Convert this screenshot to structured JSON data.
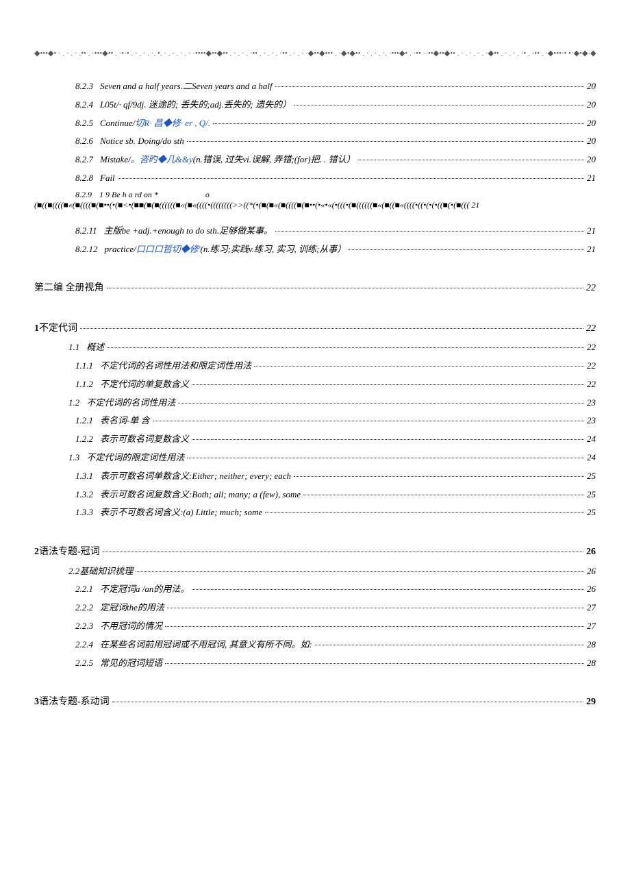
{
  "header": {
    "dots": "◆•••◆• · . · . · .•• . ·•••◆•• . ·•·• . · . · . ·. •. · . · . · . · ·••••◆••◆•• . · . · . ·•• . · . · . ·•• . · . · ·◆••◆••• . ·◆•◆•• . · . · . ·. ·•••◆• . ·•• ··••◆••◆•• . · . · . · . ·◆•• . · . · . ·• . ·•• . ·◆•••·• •·◆•◆·◆",
    "page": "20"
  },
  "entries": [
    {
      "lvl": 3,
      "num": "8.2.3",
      "txt": "Seven and a half years.二Seven years and a half",
      "pg": "20"
    },
    {
      "lvl": 3,
      "num": "8.2.4",
      "txt": "L05t/· qf/9dj. 迷途的; 丢失的;adj.丢失的; 遗失的）",
      "pg": "20"
    },
    {
      "lvl": 3,
      "num": "8.2.5",
      "txt": "Continue/<span class=\"link-blue\">切R· 昌◆修· er , Q/.</span>",
      "pg": "20"
    },
    {
      "lvl": 3,
      "num": "8.2.6",
      "txt": "Notice sb. Doing/do sth",
      "pg": "20"
    },
    {
      "lvl": 3,
      "num": "8.2.7",
      "txt": "Mistake/<span class=\"link-blue\">。咨旳◆几&&y</span>(n.错误, 过失vi.误解, 弄错;(for)把. . 错认）",
      "pg": "20"
    },
    {
      "lvl": 3,
      "num": "8.2.8",
      "txt": "Fail",
      "pg": "21"
    }
  ],
  "garbled": {
    "num": "8.2.9",
    "txt": "1  9 Be h a rd on *&nbsp;&nbsp;&nbsp;&nbsp;&nbsp;&nbsp;&nbsp;&nbsp;&nbsp;&nbsp;&nbsp;&nbsp;&nbsp;&nbsp;&nbsp;&nbsp;&nbsp;&nbsp;&nbsp;&nbsp;&nbsp;&nbsp;&nbsp;o",
    "line2": "(■((■((((■«(■((((■(■••(•(■<•(■■(■(■((((((■«(■«((((•((((((((>>((*(•(■(■«(■((((■(■••(•«•«(•(((•(■((((((■«(■((■«((((•((•(•(•((■(•(■(((  21"
  },
  "entries2": [
    {
      "lvl": 3,
      "num": "8.2.11",
      "txt": "主版be +adj.+enough to do sth.足够做某事。",
      "pg": "21"
    },
    {
      "lvl": 3,
      "num": "8.2.12",
      "txt": "practice/<span class=\"link-blue\">口口口哲切◆修'</span>(n.练习;实践v.练习, 实习, 训练;从事）",
      "pg": "21"
    },
    {
      "lvl": 0,
      "num": "",
      "txt": "第二编 全册视角",
      "pg": "<i>22</i>"
    },
    {
      "lvl": 0,
      "num": "",
      "txt": "<b>1</b>不定代词",
      "pg": "<i>22</i>"
    },
    {
      "lvl": 2,
      "num": "1.1",
      "txt": "概述",
      "pg": "22"
    },
    {
      "lvl": 3,
      "num": "1.1.1",
      "txt": "不定代词的名词性用法和限定词性用法",
      "pg": "22"
    },
    {
      "lvl": 3,
      "num": "1.1.2",
      "txt": "不定代词的单复数含义",
      "pg": "22"
    },
    {
      "lvl": 2,
      "num": "1.2",
      "txt": "不定代词的名词性用法",
      "pg": "23"
    },
    {
      "lvl": 3,
      "num": "1.2.1",
      "txt": "表名词-单  含",
      "pg": "23"
    },
    {
      "lvl": 3,
      "num": "1.2.2",
      "txt": "表示可数名词复数含义",
      "pg": "24"
    },
    {
      "lvl": 2,
      "num": "1.3",
      "txt": "不定代词的限定词性用法",
      "pg": "24"
    },
    {
      "lvl": 3,
      "num": "1.3.1",
      "txt": "表示可数名词单数含义:Either; neither; every; each",
      "pg": "25"
    },
    {
      "lvl": 3,
      "num": "1.3.2",
      "txt": "表示可数名词复数含义:Both; all; many; a (few), some",
      "pg": "25"
    },
    {
      "lvl": 3,
      "num": "1.3.3",
      "txt": "表示不可数名词含义:(a) Little; much; some",
      "pg": "25"
    },
    {
      "lvl": 0,
      "num": "",
      "txt": "<b>2</b>语法专题-冠词",
      "pg": "<b>26</b>"
    },
    {
      "lvl": 2,
      "num": "",
      "txt": "2.2基础知识梳理",
      "pg": "26"
    },
    {
      "lvl": 3,
      "num": "2.2.1",
      "txt": "不定冠词a /an的用法。",
      "pg": "26"
    },
    {
      "lvl": 3,
      "num": "2.2.2",
      "txt": "定冠词the的用法",
      "pg": "27"
    },
    {
      "lvl": 3,
      "num": "2.2.3",
      "txt": "不用冠词的情况",
      "pg": "27"
    },
    {
      "lvl": 3,
      "num": "2.2.4",
      "txt": "在某些名词前用冠词或不用冠词, 其意义有所不同。如:",
      "pg": "28"
    },
    {
      "lvl": 3,
      "num": "2.2.5",
      "txt": "常见的冠词短语",
      "pg": "28"
    },
    {
      "lvl": 0,
      "num": "",
      "txt": "<b>3</b>语法专题-系动词",
      "pg": "<b>29</b>"
    }
  ]
}
